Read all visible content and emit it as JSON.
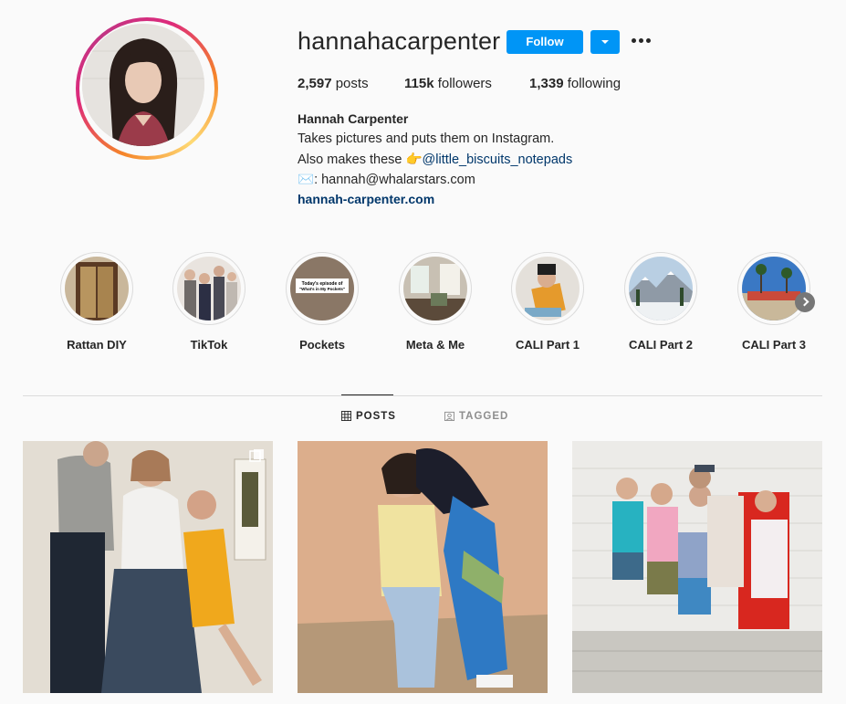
{
  "profile": {
    "username": "hannahacarpenter",
    "follow_label": "Follow",
    "stats": {
      "posts_count": "2,597",
      "posts_label": "posts",
      "followers_count": "115k",
      "followers_label": "followers",
      "following_count": "1,339",
      "following_label": "following"
    },
    "bio": {
      "name": "Hannah Carpenter",
      "line1": "Takes pictures and puts them on Instagram.",
      "line2_prefix": "Also makes these ",
      "line2_emoji": "👉",
      "line2_handle": "@little_biscuits_notepads",
      "line3_emoji": "✉️",
      "line3_text": ": hannah@whalarstars.com",
      "website": "hannah-carpenter.com"
    }
  },
  "highlights": [
    {
      "label": "Rattan DIY"
    },
    {
      "label": "TikTok"
    },
    {
      "label": "Pockets",
      "cover_text": "Today's episode of \"What's in My Pockets\""
    },
    {
      "label": "Meta & Me"
    },
    {
      "label": "CALI Part 1"
    },
    {
      "label": "CALI Part 2"
    },
    {
      "label": "CALI Part 3"
    }
  ],
  "tabs": {
    "posts": "POSTS",
    "tagged": "TAGGED"
  },
  "colors": {
    "accent": "#0095f6",
    "link": "#00376b",
    "text": "#262626",
    "background": "#fafafa",
    "border": "#dbdbdb"
  }
}
